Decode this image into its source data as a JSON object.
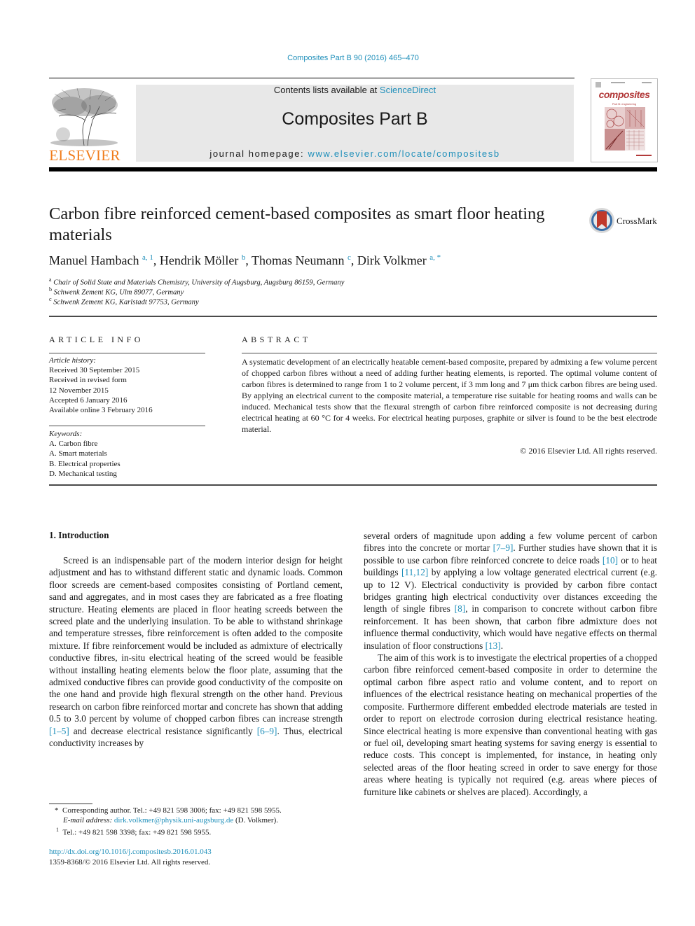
{
  "header": {
    "journal_reference": "Composites Part B 90 (2016) 465–470",
    "contents_prefix": "Contents lists available at ",
    "contents_link": "ScienceDirect",
    "journal_title": "Composites Part B",
    "homepage_prefix": "journal homepage: ",
    "homepage_link": "www.elsevier.com/locate/compositesb",
    "publisher_logo_text": "ELSEVIER",
    "cover_title": "composites",
    "cover_subtitle": "Part B: engineering",
    "crossmark_label": "CrossMark"
  },
  "colors": {
    "link": "#1f8fba",
    "elsevier_orange": "#f07c1a",
    "masthead_gray": "#e8e8e8",
    "cover_accent": "#b23a3a"
  },
  "article": {
    "title": "Carbon fibre reinforced cement-based composites as smart floor heating materials",
    "authors": [
      {
        "name": "Manuel Hambach",
        "sup": "a, 1",
        "sep": ", "
      },
      {
        "name": "Hendrik Möller",
        "sup": "b",
        "sep": ", "
      },
      {
        "name": "Thomas Neumann",
        "sup": "c",
        "sep": ", "
      },
      {
        "name": "Dirk Volkmer",
        "sup": "a, *",
        "sep": ""
      }
    ],
    "affiliations": [
      {
        "key": "a",
        "text": "Chair of Solid State and Materials Chemistry, University of Augsburg, Augsburg 86159, Germany"
      },
      {
        "key": "b",
        "text": "Schwenk Zement KG, Ulm 89077, Germany"
      },
      {
        "key": "c",
        "text": "Schwenk Zement KG, Karlstadt 97753, Germany"
      }
    ]
  },
  "article_info": {
    "heading": "ARTICLE INFO",
    "history_label": "Article history:",
    "history": [
      "Received 30 September 2015",
      "Received in revised form",
      "12 November 2015",
      "Accepted 6 January 2016",
      "Available online 3 February 2016"
    ],
    "keywords_label": "Keywords:",
    "keywords": [
      "A. Carbon fibre",
      "A. Smart materials",
      "B. Electrical properties",
      "D. Mechanical testing"
    ]
  },
  "abstract": {
    "heading": "ABSTRACT",
    "text": "A systematic development of an electrically heatable cement-based composite, prepared by admixing a few volume percent of chopped carbon fibres without a need of adding further heating elements, is reported. The optimal volume content of carbon fibres is determined to range from 1 to 2 volume percent, if 3 mm long and 7 μm thick carbon fibres are being used. By applying an electrical current to the composite material, a temperature rise suitable for heating rooms and walls can be induced. Mechanical tests show that the flexural strength of carbon fibre reinforced composite is not decreasing during electrical heating at 60 °C for 4 weeks. For electrical heating purposes, graphite or silver is found to be the best electrode material.",
    "copyright": "© 2016 Elsevier Ltd. All rights reserved."
  },
  "body": {
    "section_heading": "1.  Introduction",
    "left_column": [
      {
        "t": "Screed is an indispensable part of the modern interior design for height adjustment and has to withstand different static and dynamic loads. Common floor screeds are cement-based composites consisting of Portland cement, sand and aggregates, and in most cases they are fabricated as a free floating structure. Heating elements are placed in floor heating screeds between the screed plate and the underlying insulation. To be able to withstand shrinkage and temperature stresses, fibre reinforcement is often added to the composite mixture. If fibre reinforcement would be included as admixture of electrically conductive fibres, in-situ electrical heating of the screed would be feasible without installing heating elements below the floor plate, assuming that the admixed conductive fibres can provide good conductivity of the composite on the one hand and provide high flexural strength on the other hand. Previous research on carbon fibre reinforced mortar and concrete has shown that adding 0.5 to 3.0 percent by volume of chopped carbon fibres can increase strength "
      },
      {
        "ref": "[1–5]"
      },
      {
        "t": " and decrease electrical resistance significantly "
      },
      {
        "ref": "[6–9]"
      },
      {
        "t": ". Thus, electrical conductivity increases by"
      }
    ],
    "right_column_p1": [
      {
        "t": "several orders of magnitude upon adding a few volume percent of carbon fibres into the concrete or mortar "
      },
      {
        "ref": "[7–9]"
      },
      {
        "t": ". Further studies have shown that it is possible to use carbon fibre reinforced concrete to deice roads "
      },
      {
        "ref": "[10]"
      },
      {
        "t": " or to heat buildings "
      },
      {
        "ref": "[11,12]"
      },
      {
        "t": " by applying a low voltage generated electrical current (e.g. up to 12 V). Electrical conductivity is provided by carbon fibre contact bridges granting high electrical conductivity over distances exceeding the length of single fibres "
      },
      {
        "ref": "[8]"
      },
      {
        "t": ", in comparison to concrete without carbon fibre reinforcement. It has been shown, that carbon fibre admixture does not influence thermal conductivity, which would have negative effects on thermal insulation of floor constructions "
      },
      {
        "ref": "[13]"
      },
      {
        "t": "."
      }
    ],
    "right_column_p2": "The aim of this work is to investigate the electrical properties of a chopped carbon fibre reinforced cement-based composite in order to determine the optimal carbon fibre aspect ratio and volume content, and to report on influences of the electrical resistance heating on mechanical properties of the composite. Furthermore different embedded electrode materials are tested in order to report on electrode corrosion during electrical resistance heating. Since electrical heating is more expensive than conventional heating with gas or fuel oil, developing smart heating systems for saving energy is essential to reduce costs. This concept is implemented, for instance, in heating only selected areas of the floor heating screed in order to save energy for those areas where heating is typically not required (e.g. areas where pieces of furniture like cabinets or shelves are placed). Accordingly, a"
  },
  "footnotes": {
    "corresponding_marker": "*",
    "corresponding_text": "Corresponding author. Tel.: +49 821 598 3006; fax: +49 821 598 5955.",
    "email_label": "E-mail address: ",
    "email": "dirk.volkmer@physik.uni-augsburg.de",
    "email_suffix": " (D. Volkmer).",
    "note1_marker": "1",
    "note1_text": "Tel.: +49 821 598 3398; fax: +49 821 598 5955.",
    "doi": "http://dx.doi.org/10.1016/j.compositesb.2016.01.043",
    "issn_copyright": "1359-8368/© 2016 Elsevier Ltd. All rights reserved."
  }
}
